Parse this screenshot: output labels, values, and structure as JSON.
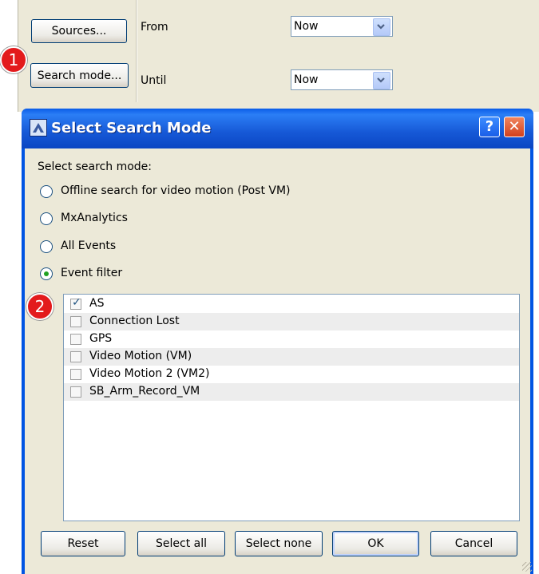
{
  "toolbar": {
    "sources_label": "Sources...",
    "search_mode_label": "Search mode...",
    "from_label": "From",
    "until_label": "Until",
    "from_value": "Now",
    "until_value": "Now",
    "marker1": "1"
  },
  "dialog": {
    "title": "Select Search Mode",
    "help_glyph": "?",
    "close_glyph": "✕",
    "prompt": "Select search mode:",
    "modes": [
      {
        "label": "Offline search for video motion (Post VM)",
        "selected": false
      },
      {
        "label": "MxAnalytics",
        "selected": false
      },
      {
        "label": "All Events",
        "selected": false
      },
      {
        "label": "Event filter",
        "selected": true
      }
    ],
    "marker2": "2",
    "events": [
      {
        "label": "AS",
        "checked": true
      },
      {
        "label": "Connection Lost",
        "checked": false
      },
      {
        "label": "GPS",
        "checked": false
      },
      {
        "label": "Video Motion (VM)",
        "checked": false
      },
      {
        "label": "Video Motion 2 (VM2)",
        "checked": false
      },
      {
        "label": "SB_Arm_Record_VM",
        "checked": false
      }
    ],
    "buttons": {
      "reset": "Reset",
      "select_all": "Select all",
      "select_none": "Select none",
      "ok": "OK",
      "cancel": "Cancel"
    }
  },
  "colors": {
    "titlebar": "#0a5ce8",
    "close_button": "#e0583a",
    "marker": "#e31a1c",
    "radio_dot": "#21a121"
  },
  "icons": [
    "dialog-app-icon",
    "help-icon",
    "close-icon",
    "dropdown-arrow-icon",
    "check-icon",
    "resize-grip-icon"
  ]
}
